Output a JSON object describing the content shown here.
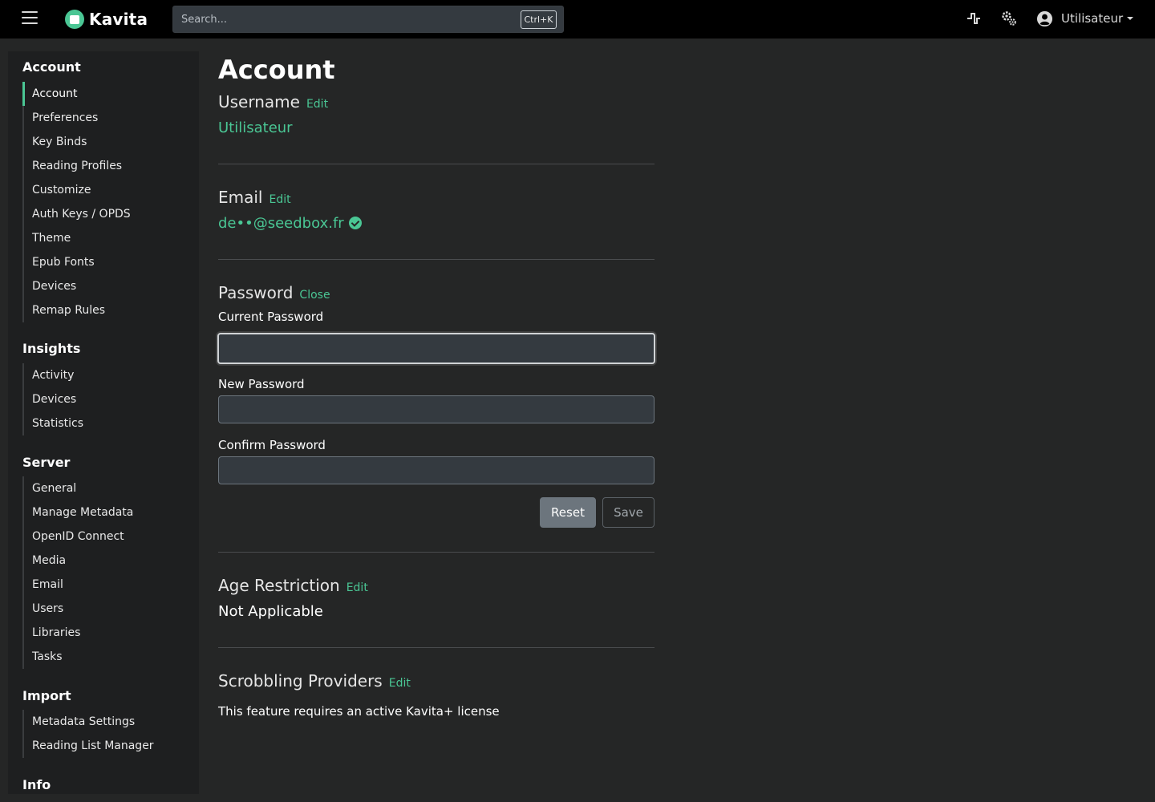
{
  "brand": {
    "name": "Kavita",
    "accent": "#4ac694"
  },
  "topbar": {
    "search_placeholder": "Search...",
    "search_shortcut": "Ctrl+K",
    "icons": [
      "menu-icon",
      "activity-icon",
      "settings-icon",
      "user-circle-icon"
    ],
    "user_name": "Utilisateur"
  },
  "sidebar": {
    "sections": [
      {
        "title": "Account",
        "items": [
          "Account",
          "Preferences",
          "Key Binds",
          "Reading Profiles",
          "Customize",
          "Auth Keys / OPDS",
          "Theme",
          "Epub Fonts",
          "Devices",
          "Remap Rules"
        ],
        "active": "Account"
      },
      {
        "title": "Insights",
        "items": [
          "Activity",
          "Devices",
          "Statistics"
        ]
      },
      {
        "title": "Server",
        "items": [
          "General",
          "Manage Metadata",
          "OpenID Connect",
          "Media",
          "Email",
          "Users",
          "Libraries",
          "Tasks"
        ]
      },
      {
        "title": "Import",
        "items": [
          "Metadata Settings",
          "Reading List Manager"
        ]
      },
      {
        "title": "Info",
        "items": []
      }
    ]
  },
  "main": {
    "title": "Account",
    "username": {
      "label": "Username",
      "action": "Edit",
      "value": "Utilisateur"
    },
    "email": {
      "label": "Email",
      "action": "Edit",
      "value": "de••@seedbox.fr",
      "verified": true
    },
    "password": {
      "label": "Password",
      "action": "Close",
      "current_label": "Current Password",
      "new_label": "New Password",
      "confirm_label": "Confirm Password",
      "current_value": "",
      "new_value": "",
      "confirm_value": "",
      "reset_label": "Reset",
      "save_label": "Save"
    },
    "age_restriction": {
      "label": "Age Restriction",
      "action": "Edit",
      "value": "Not Applicable"
    },
    "scrobbling": {
      "label": "Scrobbling Providers",
      "action": "Edit",
      "message": "This feature requires an active Kavita+ license"
    }
  }
}
